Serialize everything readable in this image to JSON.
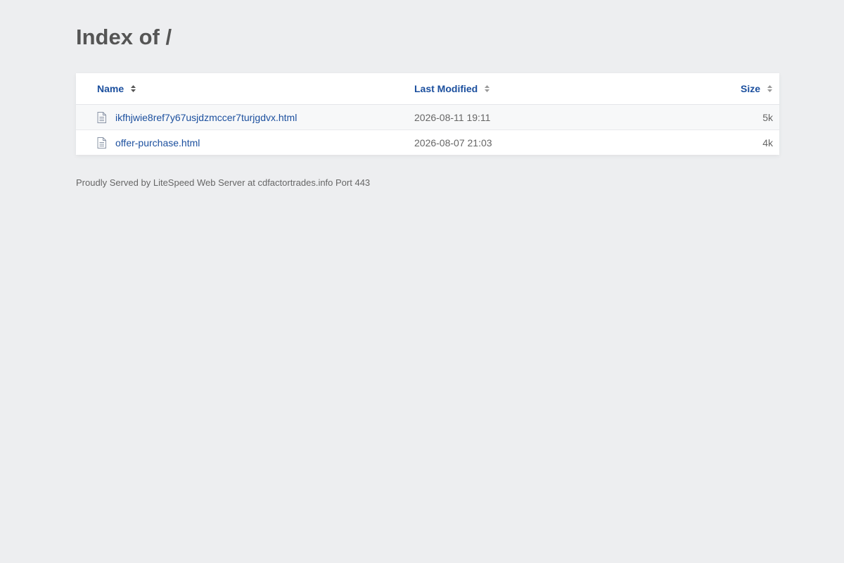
{
  "page": {
    "title": "Index of /"
  },
  "table": {
    "headers": {
      "name": "Name",
      "last_modified": "Last Modified",
      "size": "Size"
    },
    "rows": [
      {
        "name": "ikfhjwie8ref7y67usjdzmccer7turjgdvx.html",
        "modified": "2026-08-11 19:11",
        "size": "5k",
        "icon": "file-icon"
      },
      {
        "name": "offer-purchase.html",
        "modified": "2026-08-07 21:03",
        "size": "4k",
        "icon": "file-icon"
      }
    ]
  },
  "footer": {
    "text": "Proudly Served by LiteSpeed Web Server at cdfactortrades.info Port 443"
  },
  "colors": {
    "background": "#edeef0",
    "link": "#1b4f9e",
    "text": "#555555"
  }
}
